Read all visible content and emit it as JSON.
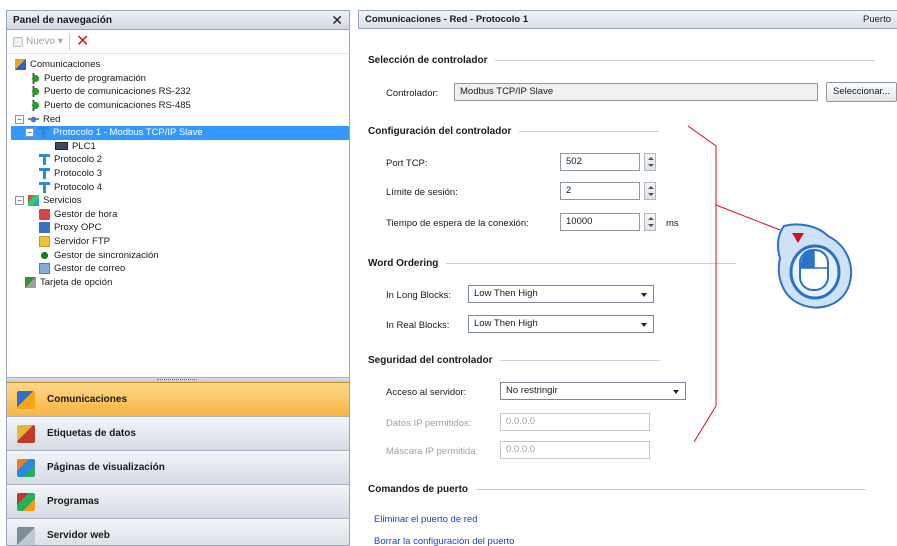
{
  "nav": {
    "title": "Panel de navegación",
    "toolbar": {
      "new_label": "Nuevo"
    },
    "tree": [
      {
        "label": "Comunicaciones",
        "icon": "communications-icon"
      },
      {
        "label": "Puerto de programación",
        "icon": "port-icon"
      },
      {
        "label": "Puerto de comunicaciones RS-232",
        "icon": "port-icon"
      },
      {
        "label": "Puerto de comunicaciones RS-485",
        "icon": "port-icon"
      },
      {
        "label": "Red",
        "icon": "network-icon"
      },
      {
        "label": "Protocolo 1 - Modbus TCP/IP Slave",
        "icon": "protocol-icon"
      },
      {
        "label": "PLC1",
        "icon": "plc-icon"
      },
      {
        "label": "Protocolo 2",
        "icon": "protocol-icon"
      },
      {
        "label": "Protocolo 3",
        "icon": "protocol-icon"
      },
      {
        "label": "Protocolo 4",
        "icon": "protocol-icon"
      },
      {
        "label": "Servicios",
        "icon": "services-icon"
      },
      {
        "label": "Gestor de hora",
        "icon": "clock-icon"
      },
      {
        "label": "Proxy OPC",
        "icon": "opc-icon"
      },
      {
        "label": "Servidor FTP",
        "icon": "ftp-icon"
      },
      {
        "label": "Gestor de sincronización",
        "icon": "sync-icon"
      },
      {
        "label": "Gestor de correo",
        "icon": "mail-icon"
      },
      {
        "label": "Tarjeta de opción",
        "icon": "option-card-icon"
      }
    ],
    "buttons": [
      {
        "label": "Comunicaciones",
        "icon": "communications-icon",
        "active": true
      },
      {
        "label": "Etiquetas de datos",
        "icon": "data-tags-icon",
        "active": false
      },
      {
        "label": "Páginas de visualización",
        "icon": "display-pages-icon",
        "active": false
      },
      {
        "label": "Programas",
        "icon": "programs-icon",
        "active": false
      },
      {
        "label": "Servidor web",
        "icon": "web-server-icon",
        "active": false
      }
    ]
  },
  "content": {
    "title": "Comunicaciones - Red - Protocolo 1",
    "header_right": "Puerto",
    "controller_selection": {
      "title": "Selección de controlador",
      "controller_label": "Controlador:",
      "controller_value": "Modbus TCP/IP Slave",
      "select_button": "Seleccionar..."
    },
    "controller_config": {
      "title": "Configuración del controlador",
      "tcp_port_label": "Port TCP:",
      "tcp_port_value": "502",
      "session_limit_label": "Límite de sesión:",
      "session_limit_value": "2",
      "timeout_label": "Tiempo de espera de la conexión:",
      "timeout_value": "10000",
      "timeout_unit": "ms"
    },
    "word_ordering": {
      "title": "Word Ordering",
      "long_blocks_label": "In Long Blocks:",
      "long_blocks_value": "Low Then High",
      "real_blocks_label": "In Real Blocks:",
      "real_blocks_value": "Low Then High"
    },
    "controller_security": {
      "title": "Seguridad del controlador",
      "server_access_label": "Acceso al servidor:",
      "server_access_value": "No restringir",
      "allowed_ip_label": "Datos IP permitidos:",
      "allowed_ip_value": "0.0.0.0",
      "allowed_mask_label": "Máscara IP permitida:",
      "allowed_mask_value": "0.0.0.0"
    },
    "port_commands": {
      "title": "Comandos de puerto",
      "delete_link": "Eliminar el puerto de red",
      "clear_link": "Borrar la configuración del puerto"
    }
  },
  "colors": {
    "selection": "#3399ff",
    "active_nav": "#f7b544",
    "annotation": "#d01020",
    "cursor_blue": "#2a72c8"
  }
}
